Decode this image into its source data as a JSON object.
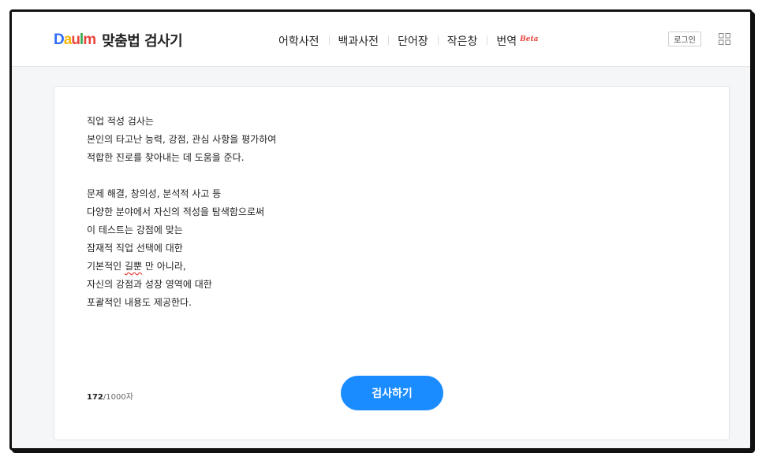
{
  "header": {
    "logo": {
      "d": "D",
      "a": "a",
      "u": "u",
      "m": "m",
      "bar": "l"
    },
    "service_name": "맞춤법 검사기",
    "nav": [
      {
        "label": "어학사전"
      },
      {
        "label": "백과사전"
      },
      {
        "label": "단어장"
      },
      {
        "label": "작은창"
      },
      {
        "label": "번역",
        "badge": "Beta"
      }
    ],
    "login_label": "로그인",
    "apps_icon": "grid-icon"
  },
  "editor": {
    "lines": [
      "직업 적성 검사는",
      "본인의 타고난 능력, 강점, 관심 사항을 평가하여",
      "적합한 진로를 찾아내는 데 도움을 준다.",
      "",
      "문제 해결, 창의성, 분석적 사고 등",
      "다양한 분야에서 자신의 적성을 탐색함으로써",
      "이 테스트는 강점에 맞는",
      "잠재적 직업 선택에 대한",
      "기본적인 ",
      "자신의 강점과 성장 영역에 대한",
      "포괄적인 내용도 제공한다."
    ],
    "typo_word": "길뿐",
    "typo_line_suffix": " 만 아니라,",
    "counter_current": "172",
    "counter_max": "/1000자",
    "check_button_label": "검사하기"
  },
  "colors": {
    "accent": "#1a8cff",
    "typo_underline": "#e8453c",
    "background": "#f5f6f7"
  }
}
